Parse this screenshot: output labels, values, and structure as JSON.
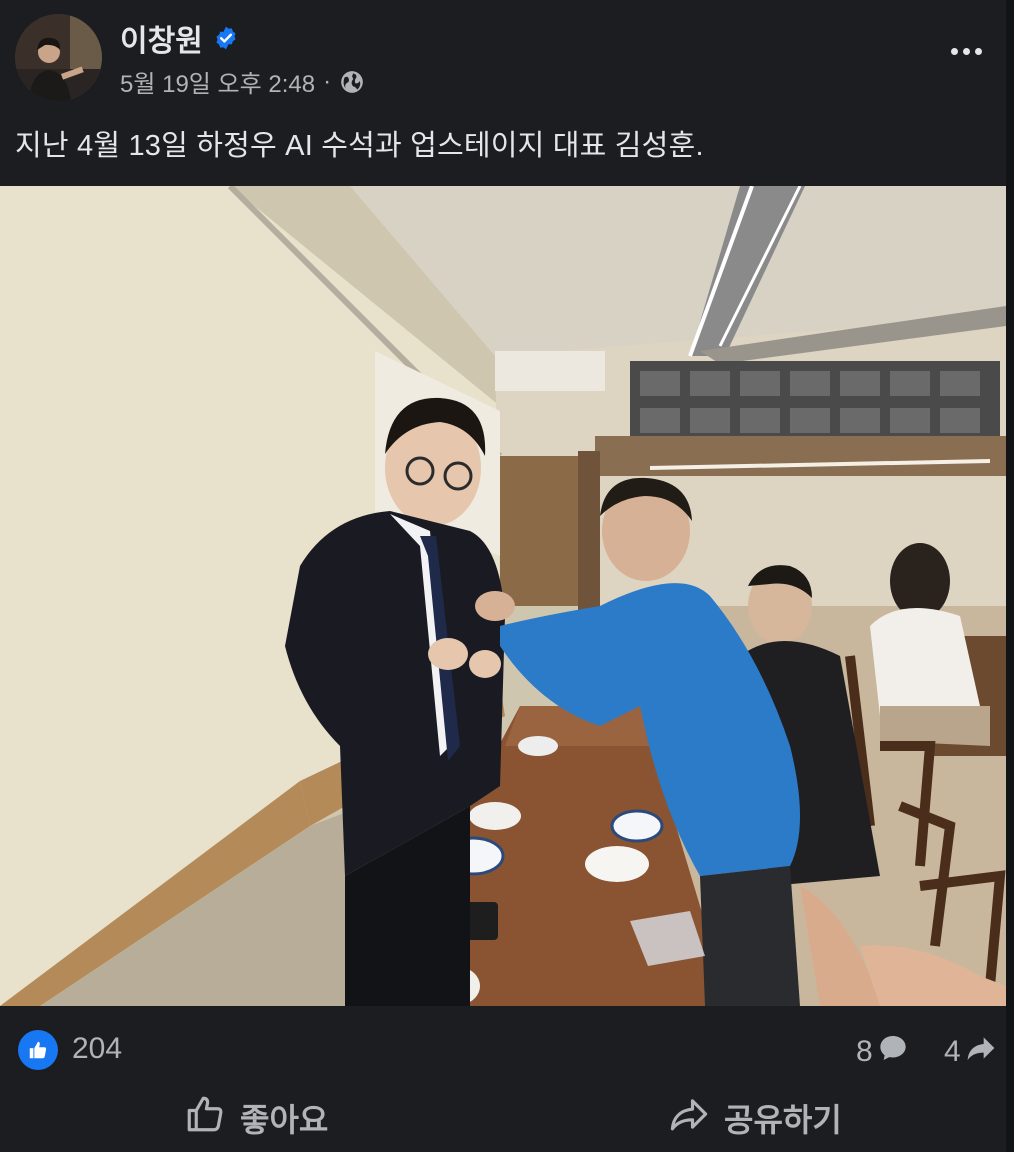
{
  "post": {
    "author": "이창원",
    "timestamp": "5월 19일 오후 2:48",
    "separator": "·",
    "caption": "지난 4월 13일 하정우 AI 수석과 업스테이지 대표 김성훈."
  },
  "stats": {
    "like_count": "204",
    "comment_count": "8",
    "share_count": "4"
  },
  "actions": {
    "like_label": "좋아요",
    "share_label": "공유하기"
  },
  "colors": {
    "accent": "#1877f2",
    "background": "#1c1d20",
    "text_primary": "#e4e6eb",
    "text_secondary": "#b0b3b8"
  },
  "icons": {
    "verified": "verified-badge-icon",
    "audience": "globe-icon",
    "more": "more-options-icon",
    "like_reaction": "thumbs-up-icon",
    "comment": "comment-bubble-icon",
    "share": "share-arrow-icon"
  }
}
